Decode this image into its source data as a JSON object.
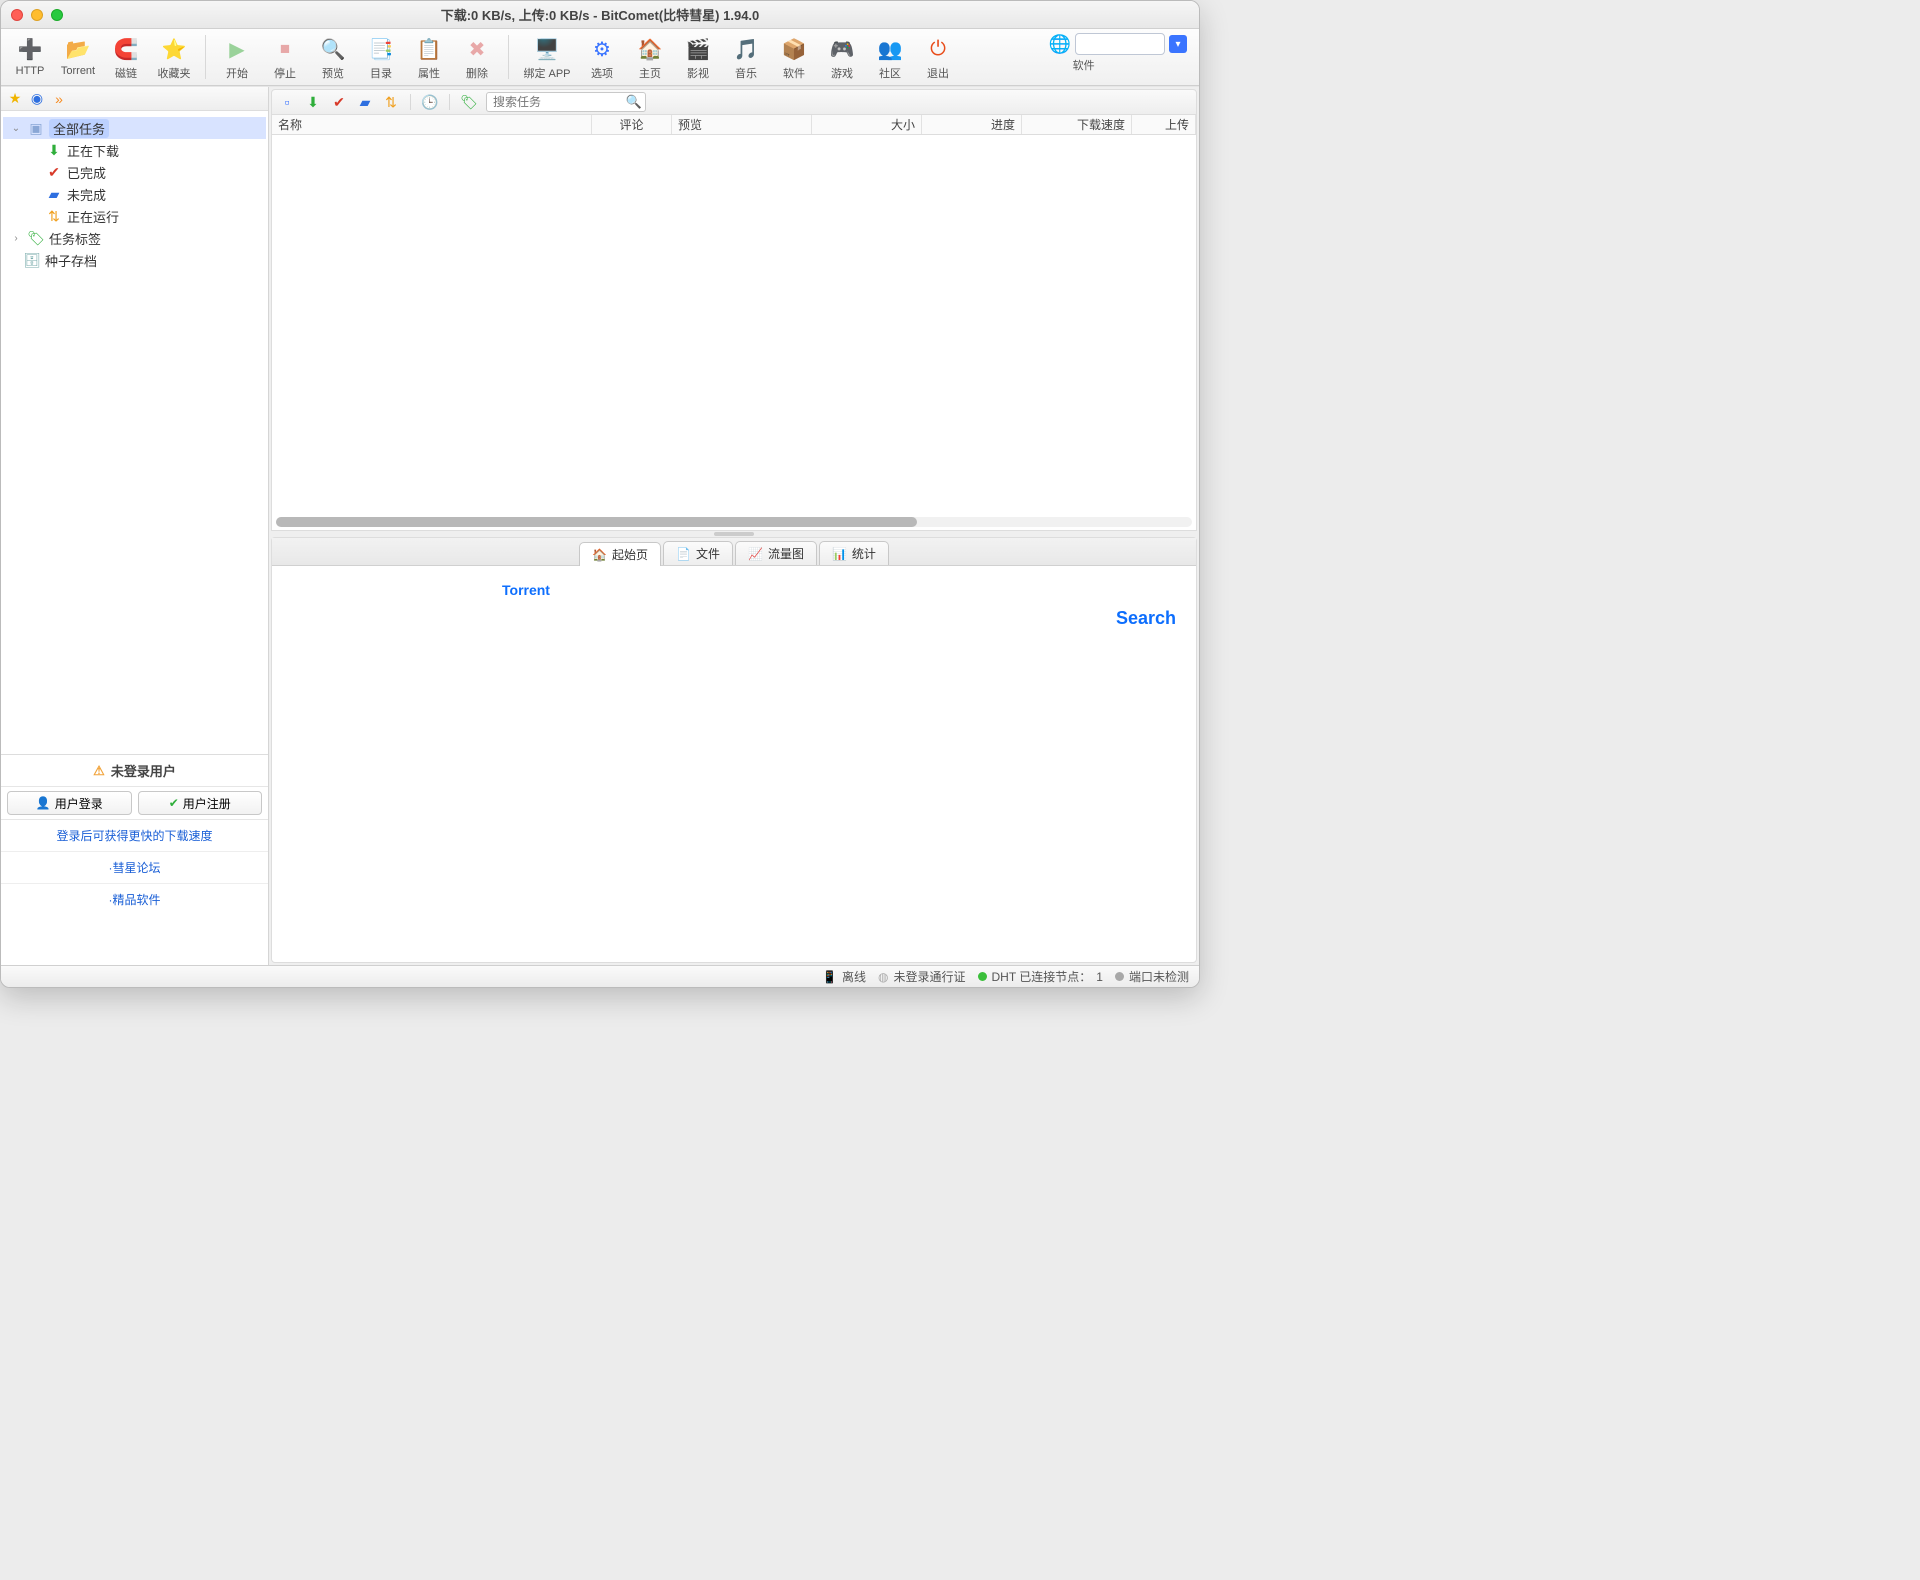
{
  "title": "下载:0 KB/s, 上传:0 KB/s - BitComet(比特彗星) 1.94.0",
  "toolbar": {
    "http": "HTTP",
    "torrent": "Torrent",
    "magnet": "磁链",
    "fav": "收藏夹",
    "start": "开始",
    "stop": "停止",
    "preview": "预览",
    "list": "目录",
    "prop": "属性",
    "delete": "删除",
    "bind": "绑定 APP",
    "opts": "选项",
    "home": "主页",
    "video": "影视",
    "music": "音乐",
    "soft": "软件",
    "game": "游戏",
    "commu": "社区",
    "exit": "退出",
    "software_label": "软件"
  },
  "left_tabs": {
    "fav": "★",
    "globe": "◉",
    "rss": "»"
  },
  "tree": {
    "all": "全部任务",
    "downloading": "正在下载",
    "done": "已完成",
    "incomplete": "未完成",
    "running": "正在运行",
    "tags": "任务标签",
    "seeds": "种子存档"
  },
  "user": {
    "title": "未登录用户",
    "login": "用户登录",
    "register": "用户注册",
    "link1": "登录后可获得更快的下载速度",
    "link2": "·彗星论坛",
    "link3": "·精品软件"
  },
  "task_search_ph": "搜索任务",
  "cols": {
    "name": "名称",
    "comment": "评论",
    "preview": "预览",
    "size": "大小",
    "progress": "进度",
    "dlspeed": "下载速度",
    "ulspeed": "上传"
  },
  "btabs": {
    "start": "起始页",
    "files": "文件",
    "traffic": "流量图",
    "stats": "统计"
  },
  "bcontent": {
    "torrent": "Torrent",
    "search": "Search"
  },
  "status": {
    "offline": "离线",
    "nopass": "未登录通行证",
    "dht": "DHT 已连接节点：",
    "dht_n": "1",
    "port": "端口未检测"
  }
}
